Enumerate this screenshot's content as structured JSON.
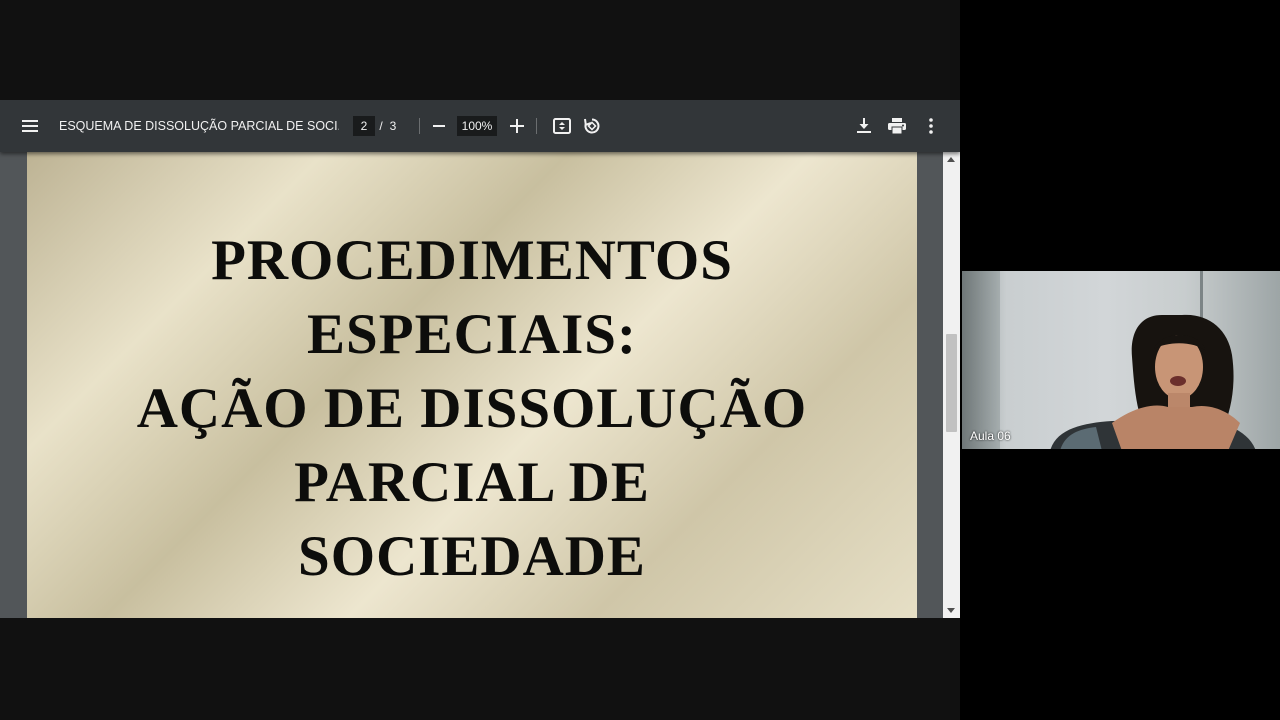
{
  "viewer": {
    "title": "ESQUEMA DE DISSOLUÇÃO PARCIAL DE SOCI...",
    "current_page": "2",
    "page_separator": "/",
    "total_pages": "3",
    "zoom": "100%",
    "icons": {
      "menu": "menu-icon",
      "zoom_out": "minus-icon",
      "zoom_in": "plus-icon",
      "fit": "fit-page-icon",
      "rotate": "rotate-icon",
      "download": "download-icon",
      "print": "print-icon",
      "more": "more-vert-icon"
    }
  },
  "slide": {
    "lines": [
      "PROCEDIMENTOS",
      "ESPECIAIS:",
      "AÇÃO DE DISSOLUÇÃO",
      "PARCIAL DE",
      "SOCIEDADE"
    ]
  },
  "participant": {
    "name": "Aula 06"
  }
}
